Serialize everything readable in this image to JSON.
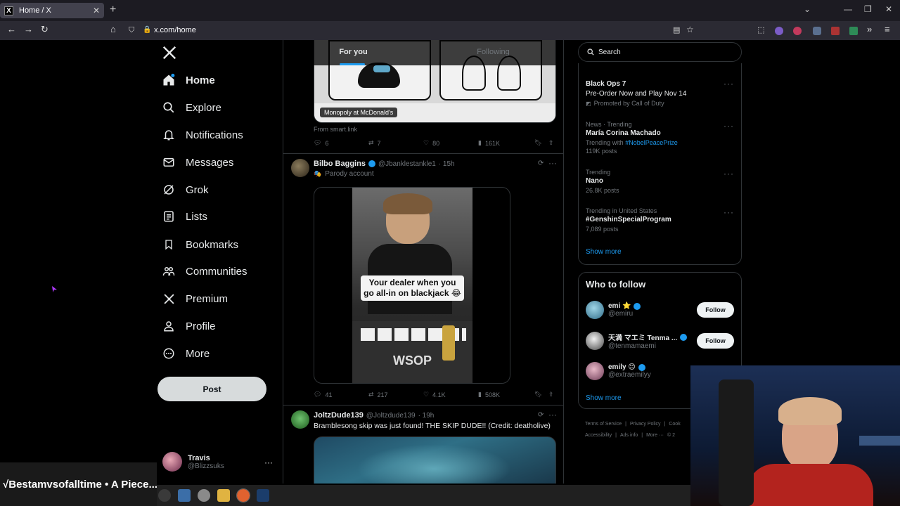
{
  "browser": {
    "tab_title": "Home / X",
    "url": "x.com/home"
  },
  "nav": {
    "items": [
      {
        "label": "Home",
        "icon": "home-icon"
      },
      {
        "label": "Explore",
        "icon": "search-icon"
      },
      {
        "label": "Notifications",
        "icon": "bell-icon"
      },
      {
        "label": "Messages",
        "icon": "mail-icon"
      },
      {
        "label": "Grok",
        "icon": "grok-icon"
      },
      {
        "label": "Lists",
        "icon": "list-icon"
      },
      {
        "label": "Bookmarks",
        "icon": "bookmark-icon"
      },
      {
        "label": "Communities",
        "icon": "people-icon"
      },
      {
        "label": "Premium",
        "icon": "x-logo-icon"
      },
      {
        "label": "Profile",
        "icon": "person-icon"
      },
      {
        "label": "More",
        "icon": "more-circle-icon"
      }
    ],
    "post_label": "Post"
  },
  "account": {
    "name": "Travis",
    "handle": "@Blizzsuks"
  },
  "feed": {
    "tabs": [
      "For you",
      "Following"
    ],
    "ad_card": {
      "image_label": "Monopoly at McDonald's",
      "source": "From smart.link",
      "replies": "6",
      "reposts": "7",
      "likes": "80",
      "views": "161K"
    },
    "tweets": [
      {
        "name": "Bilbo Baggins",
        "handle": "@Jbanklestankle1",
        "time": "· 15h",
        "badge": "Parody account",
        "video_caption": "Your dealer when you go all-in on blackjack 😂",
        "replies": "41",
        "reposts": "217",
        "likes": "4.1K",
        "views": "508K"
      },
      {
        "name": "JoltzDude139",
        "handle": "@Joltzdude139",
        "time": "· 19h",
        "text": "Bramblesong skip was just found! THE SKIP DUDE!! (Credit: deatholive)"
      }
    ]
  },
  "search": {
    "placeholder": "Search"
  },
  "trends": [
    {
      "meta": "",
      "title": "Black Ops 7",
      "sub": "Pre-Order Now and Play Nov 14",
      "extra": "Promoted by Call of Duty"
    },
    {
      "meta": "News · Trending",
      "title": "María Corina Machado",
      "sub": "Trending with",
      "tag": "#NobelPeacePrize",
      "extra": "119K posts"
    },
    {
      "meta": "Trending",
      "title": "Nano",
      "extra": "26.8K posts"
    },
    {
      "meta": "Trending in United States",
      "title": "#GenshinSpecialProgram",
      "extra": "7,089 posts"
    }
  ],
  "show_more": "Show more",
  "who_to_follow": {
    "title": "Who to follow",
    "people": [
      {
        "name": "emi ⭐",
        "handle": "@emiru"
      },
      {
        "name": "天満 マエミ Tenma ...",
        "handle": "@tenmamaemi"
      },
      {
        "name": "emily 😊",
        "handle": "@extraemilyy"
      }
    ],
    "follow_label": "Follow",
    "show_more": "Show more"
  },
  "footer": {
    "line1": [
      "Terms of Service",
      "|",
      "Privacy Policy",
      "|",
      "Cook"
    ],
    "line2": [
      "Accessibility",
      "|",
      "Ads info",
      "|",
      "More ···",
      "© 2"
    ]
  },
  "stream_title": "√Bestamvsofalltime • A Piece..."
}
